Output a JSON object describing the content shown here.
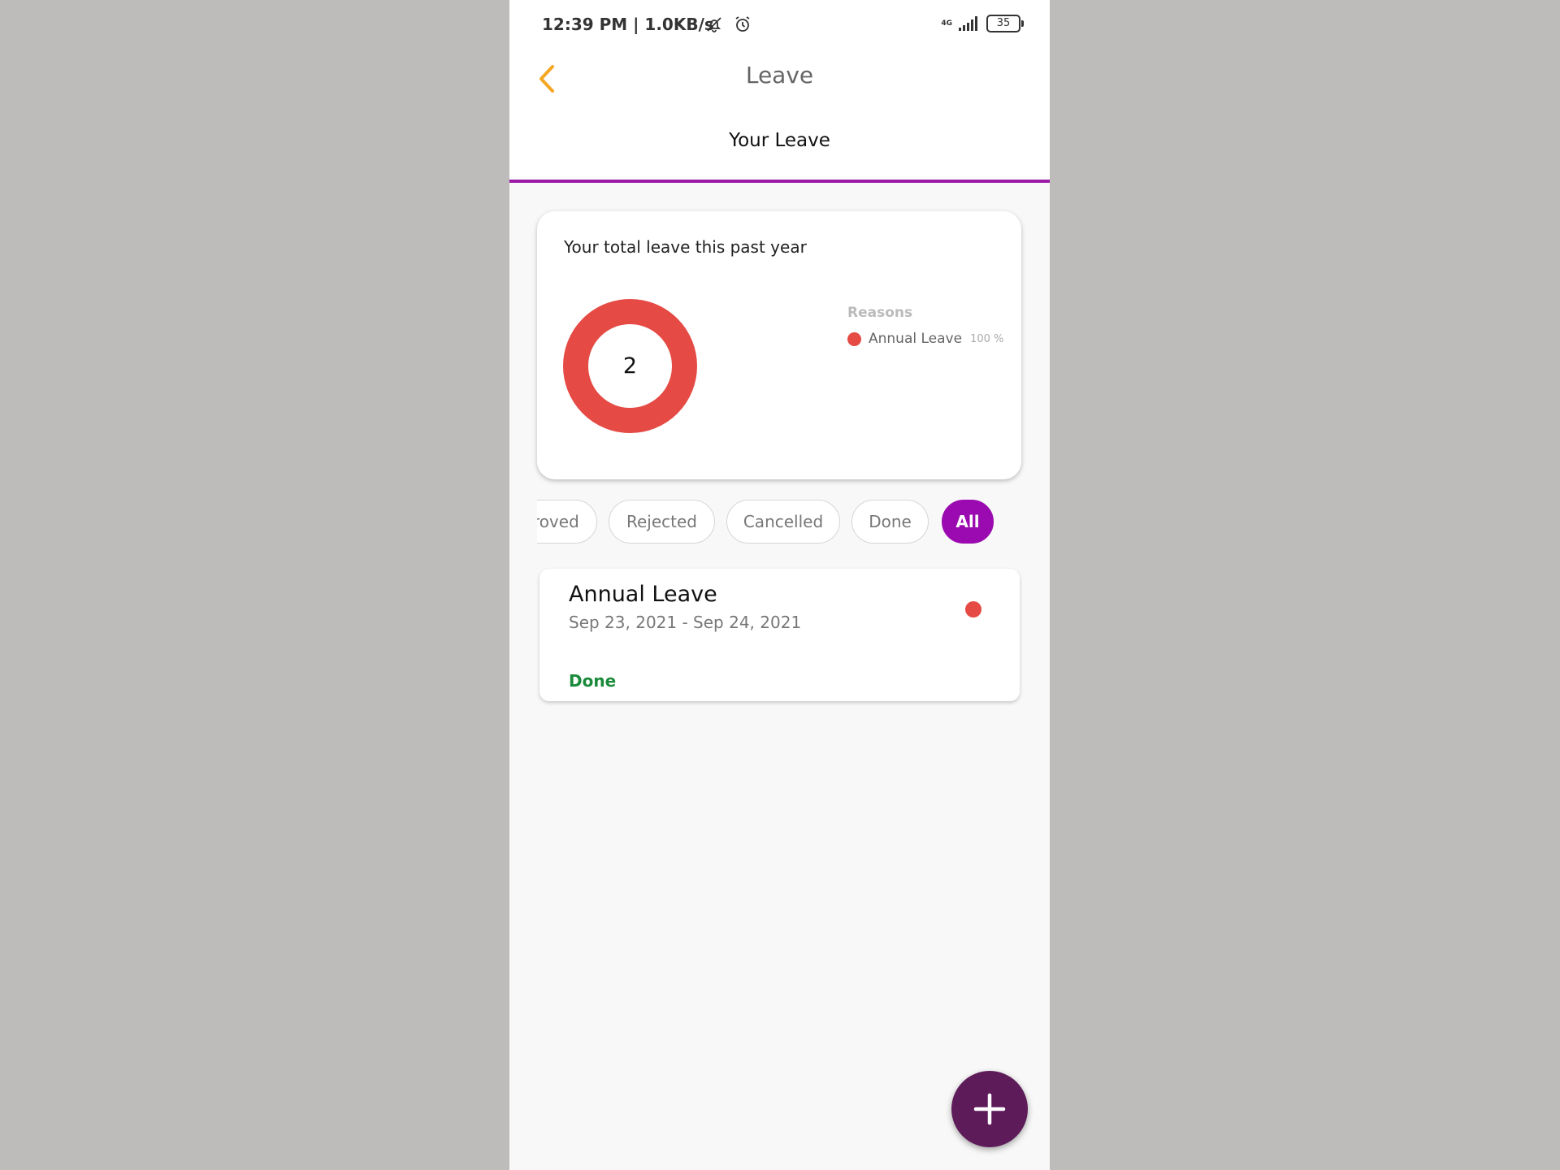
{
  "status_bar": {
    "time": "12:39 PM | 1.0KB/s",
    "network": "4G",
    "battery": "35"
  },
  "header": {
    "title": "Leave",
    "back_icon": "chevron-left-icon",
    "accent_color": "#f5a623"
  },
  "tabs": [
    {
      "label": "Your Leave",
      "selected": true
    }
  ],
  "summary": {
    "title": "Your total leave this past year",
    "total": "2",
    "legend_title": "Reasons",
    "legend": [
      {
        "label": "Annual Leave",
        "percent": "100 %",
        "color": "#e54a44"
      }
    ]
  },
  "chart_data": {
    "type": "pie",
    "categories": [
      "Annual Leave"
    ],
    "values": [
      100
    ],
    "title": "Your total leave this past year",
    "xlabel": "",
    "ylabel": ""
  },
  "filters": [
    {
      "label": "proved",
      "selected": false
    },
    {
      "label": "Rejected",
      "selected": false
    },
    {
      "label": "Cancelled",
      "selected": false
    },
    {
      "label": "Done",
      "selected": false
    },
    {
      "label": "All",
      "selected": true
    }
  ],
  "leave_items": [
    {
      "type": "Annual Leave",
      "dates": "Sep 23, 2021 - Sep 24, 2021",
      "status": "Done",
      "color": "#e54a44"
    }
  ],
  "fab": {
    "icon": "plus-icon",
    "color": "#5e1b5a"
  }
}
